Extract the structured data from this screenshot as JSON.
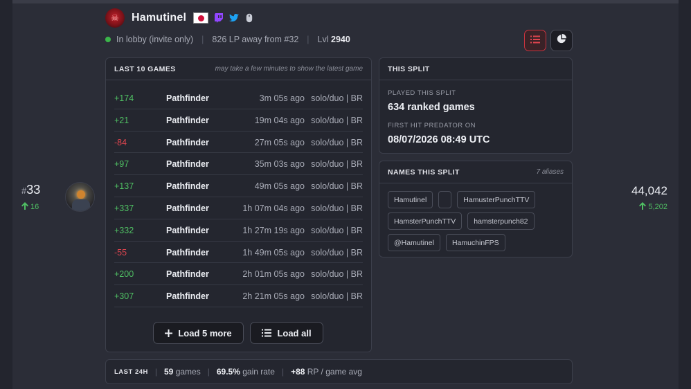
{
  "player": {
    "name": "Hamutinel",
    "logo_icon": "skull-logo",
    "flag": "japan-flag",
    "socials": [
      "twitch-icon",
      "twitter-icon",
      "mouse-icon"
    ]
  },
  "status": {
    "presence": "In lobby (invite only)",
    "lp_away": "826 LP away from #32",
    "level_label": "Lvl",
    "level_value": "2940"
  },
  "view_toggle": {
    "list_icon": "list-icon",
    "pie_icon": "pie-chart-icon",
    "active": "list"
  },
  "last_games": {
    "title": "LAST 10 GAMES",
    "note": "may take a few minutes to show the latest game",
    "rows": [
      {
        "lp": "+174",
        "legend": "Pathfinder",
        "time": "3m 05s ago",
        "mode": "solo/duo | BR",
        "positive": true
      },
      {
        "lp": "+21",
        "legend": "Pathfinder",
        "time": "19m 04s ago",
        "mode": "solo/duo | BR",
        "positive": true
      },
      {
        "lp": "-84",
        "legend": "Pathfinder",
        "time": "27m 05s ago",
        "mode": "solo/duo | BR",
        "positive": false
      },
      {
        "lp": "+97",
        "legend": "Pathfinder",
        "time": "35m 03s ago",
        "mode": "solo/duo | BR",
        "positive": true
      },
      {
        "lp": "+137",
        "legend": "Pathfinder",
        "time": "49m 05s ago",
        "mode": "solo/duo | BR",
        "positive": true
      },
      {
        "lp": "+337",
        "legend": "Pathfinder",
        "time": "1h 07m 04s ago",
        "mode": "solo/duo | BR",
        "positive": true
      },
      {
        "lp": "+332",
        "legend": "Pathfinder",
        "time": "1h 27m 19s ago",
        "mode": "solo/duo | BR",
        "positive": true
      },
      {
        "lp": "-55",
        "legend": "Pathfinder",
        "time": "1h 49m 05s ago",
        "mode": "solo/duo | BR",
        "positive": false
      },
      {
        "lp": "+200",
        "legend": "Pathfinder",
        "time": "2h 01m 05s ago",
        "mode": "solo/duo | BR",
        "positive": true
      },
      {
        "lp": "+307",
        "legend": "Pathfinder",
        "time": "2h 21m 05s ago",
        "mode": "solo/duo | BR",
        "positive": true
      }
    ],
    "load_more_label": "Load 5 more",
    "load_all_label": "Load all"
  },
  "this_split": {
    "title": "THIS SPLIT",
    "played_label": "PLAYED THIS SPLIT",
    "played_value": "634 ranked games",
    "first_pred_label": "FIRST HIT PREDATOR ON",
    "first_pred_value": "08/07/2026 08:49 UTC"
  },
  "names_split": {
    "title": "NAMES THIS SPLIT",
    "count": "7 aliases",
    "aliases": [
      "Hamutinel",
      "",
      "HamusterPunchTTV",
      "HamsterPunchTTV",
      "hamsterpunch82",
      "@Hamutinel",
      "HamuchinFPS"
    ]
  },
  "rank": {
    "hash": "#",
    "value": "33",
    "change": "16"
  },
  "lp": {
    "total": "44,042",
    "change": "5,202"
  },
  "last24": {
    "tag": "LAST 24H",
    "games_value": "59",
    "games_label": "games",
    "gain_value": "69.5%",
    "gain_label": "gain rate",
    "rp_value": "+88",
    "rp_label": "RP / game avg"
  },
  "colors": {
    "positive": "#4fbf63",
    "negative": "#e0454f",
    "accent": "#c9333f",
    "online": "#3bb54a"
  }
}
